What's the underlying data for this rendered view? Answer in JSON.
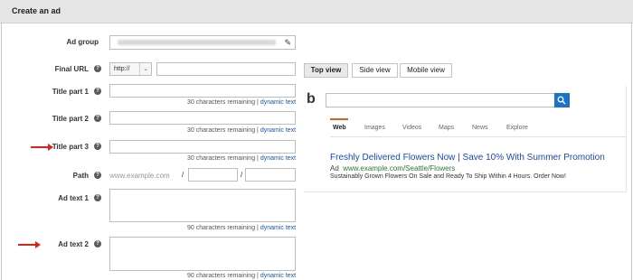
{
  "header": {
    "title": "Create an ad"
  },
  "form": {
    "ad_group": {
      "label": "Ad group"
    },
    "final_url": {
      "label": "Final URL",
      "protocol": "http://",
      "value": ""
    },
    "title1": {
      "label": "Title part 1",
      "remaining": "30 characters remaining |",
      "dynamic": "dynamic text"
    },
    "title2": {
      "label": "Title part 2",
      "remaining": "30 characters remaining |",
      "dynamic": "dynamic text"
    },
    "title3": {
      "label": "Title part 3",
      "remaining": "30 characters remaining |",
      "dynamic": "dynamic text"
    },
    "path": {
      "label": "Path",
      "domain": "www.example.com",
      "slash1": "/",
      "slash2": "/"
    },
    "ad_text1": {
      "label": "Ad text 1",
      "remaining": "90 characters remaining |",
      "dynamic": "dynamic text"
    },
    "ad_text2": {
      "label": "Ad text 2",
      "remaining": "90 characters remaining |",
      "dynamic": "dynamic text"
    },
    "help_symbol": "?"
  },
  "preview": {
    "tabs": [
      "Top view",
      "Side view",
      "Mobile view"
    ],
    "active_tab": "Top view",
    "logo": "b",
    "nav": [
      "Web",
      "Images",
      "Videos",
      "Maps",
      "News",
      "Explore"
    ],
    "ad": {
      "title": "Freshly Delivered Flowers Now | Save 10% With Summer Promotion",
      "badge": "Ad",
      "url": "www.example.com/Seattle/Flowers",
      "description": "Sustainably Grown Flowers On Sale and Ready To Ship Within 4 Hours. Order Now!"
    }
  },
  "colors": {
    "accent_red": "#d9241b",
    "link_blue": "#1a47b8",
    "url_green": "#2a7a2a",
    "search_button": "#1b73c9",
    "nav_accent": "#e35a1c"
  },
  "icons": [
    "help-icon",
    "pencil-icon",
    "search-icon",
    "bing-logo-icon",
    "red-arrow-indicator"
  ]
}
